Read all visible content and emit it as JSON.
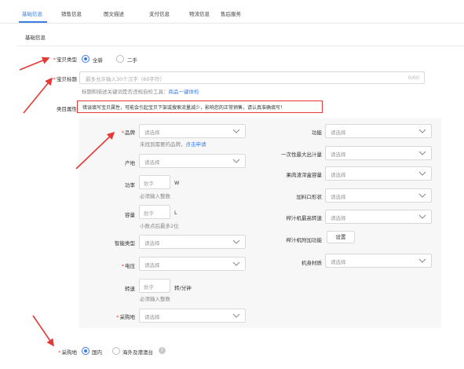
{
  "tabs": [
    "基础信息",
    "销售信息",
    "图文描述",
    "支付信息",
    "物流信息",
    "售后服务"
  ],
  "section_title": "基础信息",
  "item_type": {
    "label": "宝贝类型",
    "options": [
      "全新",
      "二手"
    ],
    "selected": "全新"
  },
  "item_title": {
    "label": "宝贝标题",
    "placeholder": "最多允许输入30个汉字（60字符）",
    "count": "0/60",
    "hint_prefix": "标题和描述关键词是否违规自检工具：",
    "hint_link": "商品一键体检"
  },
  "category_attr": {
    "label": "类目属性",
    "warning": "错误填写宝贝属性，可能会引起宝贝下架或搜索流量减少，影响您的正常销售，请认真准确填写！"
  },
  "select_placeholder": "请选择",
  "number_placeholder": "数字",
  "left_attrs": {
    "brand": {
      "label": "品牌",
      "hint": "未找到需要的品牌，",
      "hint_link": "点击申请"
    },
    "origin": {
      "label": "产地"
    },
    "power": {
      "label": "功率",
      "unit": "W",
      "hint": "必须输入整数"
    },
    "capacity": {
      "label": "容量",
      "unit": "L",
      "hint": "小数点后最多2位"
    },
    "smart_type": {
      "label": "智能类型"
    },
    "voltage": {
      "label": "电压"
    },
    "speed": {
      "label": "转速",
      "unit": "转/分钟",
      "hint": "必须输入整数"
    },
    "purchase_place": {
      "label": "采购地"
    }
  },
  "right_attrs": {
    "function": {
      "label": "功能"
    },
    "juice_amount": {
      "label": "一次性最大出汁量"
    },
    "pulp_capacity": {
      "label": "果肉渣滓盒容量"
    },
    "feed_shape": {
      "label": "加料口形状"
    },
    "max_speed": {
      "label": "榨汁机最高转速"
    },
    "extra_function": {
      "label": "榨汁机附加功能",
      "button": "设置"
    },
    "body_material": {
      "label": "机身材质"
    }
  },
  "purchase_location": {
    "label": "采购地",
    "options": [
      "国内",
      "海外及港澳台"
    ],
    "selected": "国内",
    "help_icon": "question-circle-icon"
  },
  "colors": {
    "accent": "#3b7de6",
    "required": "#ff3b30",
    "annotation": "#e53935"
  }
}
